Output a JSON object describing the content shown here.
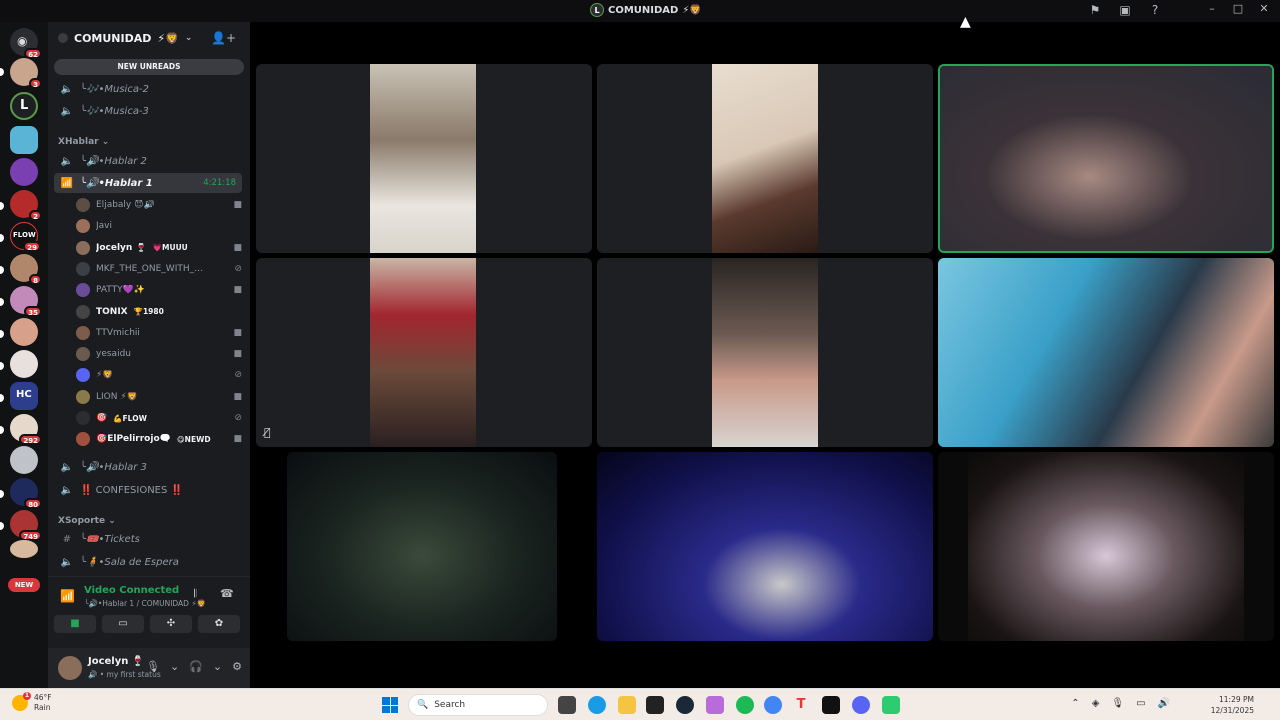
{
  "titlebar": {
    "title": "COMUNIDAD",
    "title_emojis": "⚡🦁",
    "icons": [
      "flag-icon",
      "inbox-icon",
      "help-icon"
    ]
  },
  "servers": {
    "badges": [
      "62",
      "3",
      "2",
      "29",
      "8",
      "35",
      "292",
      "80",
      "749"
    ],
    "new_label": "NEW"
  },
  "sidebar": {
    "guild_name": "COMUNIDAD",
    "guild_emojis": "⚡🦁",
    "new_unreads": "NEW UNREADS",
    "channels": {
      "musica2": "╰🎶•Musica-2",
      "musica3": "╰🎶•Musica-3",
      "hablar2": "╰🔊•Hablar 2",
      "hablar1": "╰🔊•Hablar 1",
      "hablar1_timer": "4:21:18",
      "hablar3": "╰🔊•Hablar 3",
      "confesiones": "‼️ CONFESIONES ‼️",
      "tickets": "╰🎟️•Tickets",
      "sala": "╰🧍•Sala de Espera"
    },
    "categories": {
      "hablar": "XHablar",
      "soporte": "XSoporte"
    },
    "voice_users": [
      {
        "name": "Eljabaly 😈🔊",
        "tag": "",
        "color": "#5d4e44"
      },
      {
        "name": "Javi",
        "tag": "",
        "color": "#9b6f5a"
      },
      {
        "name": "Jocelyn 🍷",
        "tag": "💗MUUU",
        "color": "#8a6d5b"
      },
      {
        "name": "MKF_THE_ONE_WITH_N...",
        "tag": "",
        "color": "#3b3f46"
      },
      {
        "name": "PATTY💜✨",
        "tag": "",
        "color": "#6b4c9a"
      },
      {
        "name": "TONIX",
        "tag": "🏆1980",
        "color": "#444"
      },
      {
        "name": "TTVmichii",
        "tag": "",
        "color": "#7c5c4a"
      },
      {
        "name": "yesaidu",
        "tag": "",
        "color": "#6b5a4e"
      },
      {
        "name": "⚡🦁",
        "tag": "",
        "color": "#5865f2"
      },
      {
        "name": "LION ⚡🦁",
        "tag": "",
        "color": "#8a7a4a"
      },
      {
        "name": "🎯",
        "tag": "💪FLOW",
        "color": "#2b2d31"
      },
      {
        "name": "🎯ElPelirrojo🗨️",
        "tag": "😋NEWD",
        "color": "#a0503c"
      }
    ],
    "voice_connected": {
      "title": "Video Connected",
      "subtitle": "╰🔊•Hablar 1 / COMUNIDAD ⚡🦁"
    },
    "user": {
      "name": "Jocelyn 🍷",
      "status": "🔊 • my first status"
    }
  },
  "taskbar": {
    "temperature": "46°F",
    "condition": "Rain",
    "search_placeholder": "Search",
    "time": "11:29 PM",
    "date": "12/31/2025"
  }
}
